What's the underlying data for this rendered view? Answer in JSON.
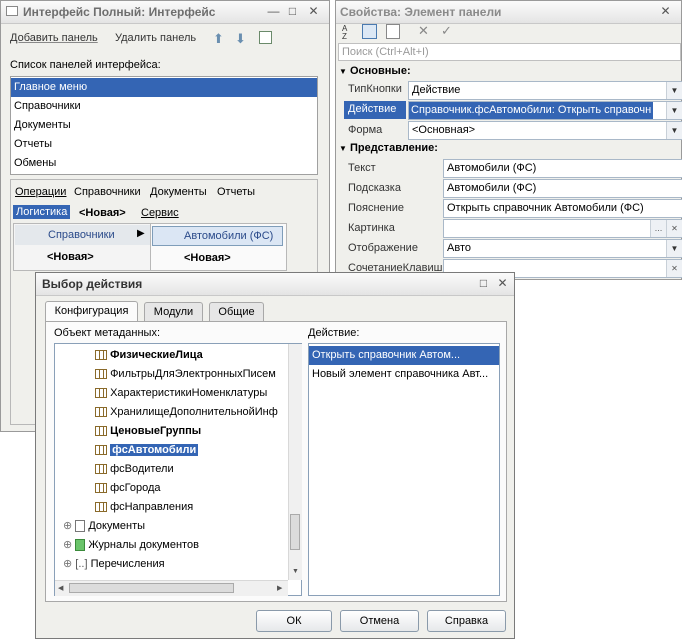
{
  "interface_window": {
    "title": "Интерфейс Полный: Интерфейс",
    "toolbar": {
      "add_panel": "Добавить панель",
      "remove_panel": "Удалить панель"
    },
    "panels_label": "Список панелей интерфейса:",
    "panels": [
      "Главное меню",
      "Справочники",
      "Документы",
      "Отчеты",
      "Обмены"
    ],
    "menu_row1": [
      "Операции",
      "Справочники",
      "Документы",
      "Отчеты"
    ],
    "menu_row2": {
      "selected": "Логистика",
      "new": "<Новая>",
      "service": "Сервис"
    },
    "submenu": {
      "item": "Справочники",
      "new": "<Новая>"
    },
    "submenu2": {
      "item": "Автомобили (ФС)",
      "new": "<Новая>"
    }
  },
  "properties_window": {
    "title": "Свойства: Элемент панели",
    "search_placeholder": "Поиск (Ctrl+Alt+I)",
    "section_main": "Основные:",
    "section_view": "Представление:",
    "fields": {
      "button_type_label": "ТипКнопки",
      "button_type_value": "Действие",
      "action_label": "Действие",
      "action_value": "Справочник.фсАвтомобили: Открыть справочн",
      "form_label": "Форма",
      "form_value": "<Основная>",
      "text_label": "Текст",
      "text_value": "Автомобили (ФС)",
      "tooltip_label": "Подсказка",
      "tooltip_value": "Автомобили (ФС)",
      "explanation_label": "Пояснение",
      "explanation_value": "Открыть справочник Автомобили (ФС)",
      "picture_label": "Картинка",
      "picture_value": "",
      "display_label": "Отображение",
      "display_value": "Авто",
      "shortcut_label": "СочетаниеКлавиш",
      "shortcut_value": ""
    }
  },
  "action_dialog": {
    "title": "Выбор действия",
    "tabs": [
      "Конфигурация",
      "Модули",
      "Общие"
    ],
    "metadata_label": "Объект метаданных:",
    "action_label": "Действие:",
    "tree_items": [
      {
        "label": "ФизическиеЛица",
        "bold": true
      },
      {
        "label": "ФильтрыДляЭлектронныхПисем",
        "bold": false
      },
      {
        "label": "ХарактеристикиНоменклатуры",
        "bold": false
      },
      {
        "label": "ХранилищеДополнительнойИнф",
        "bold": false
      },
      {
        "label": "ЦеновыеГруппы",
        "bold": true
      },
      {
        "label": "фсАвтомобили",
        "bold": true
      },
      {
        "label": "фсВодители",
        "bold": false
      },
      {
        "label": "фсГорода",
        "bold": false
      },
      {
        "label": "фсНаправления",
        "bold": false
      }
    ],
    "tree_groups": [
      "Документы",
      "Журналы документов",
      "Перечисления"
    ],
    "actions": [
      "Открыть справочник Автом...",
      "Новый элемент справочника Авт..."
    ],
    "buttons": {
      "ok": "ОК",
      "cancel": "Отмена",
      "help": "Справка"
    }
  }
}
